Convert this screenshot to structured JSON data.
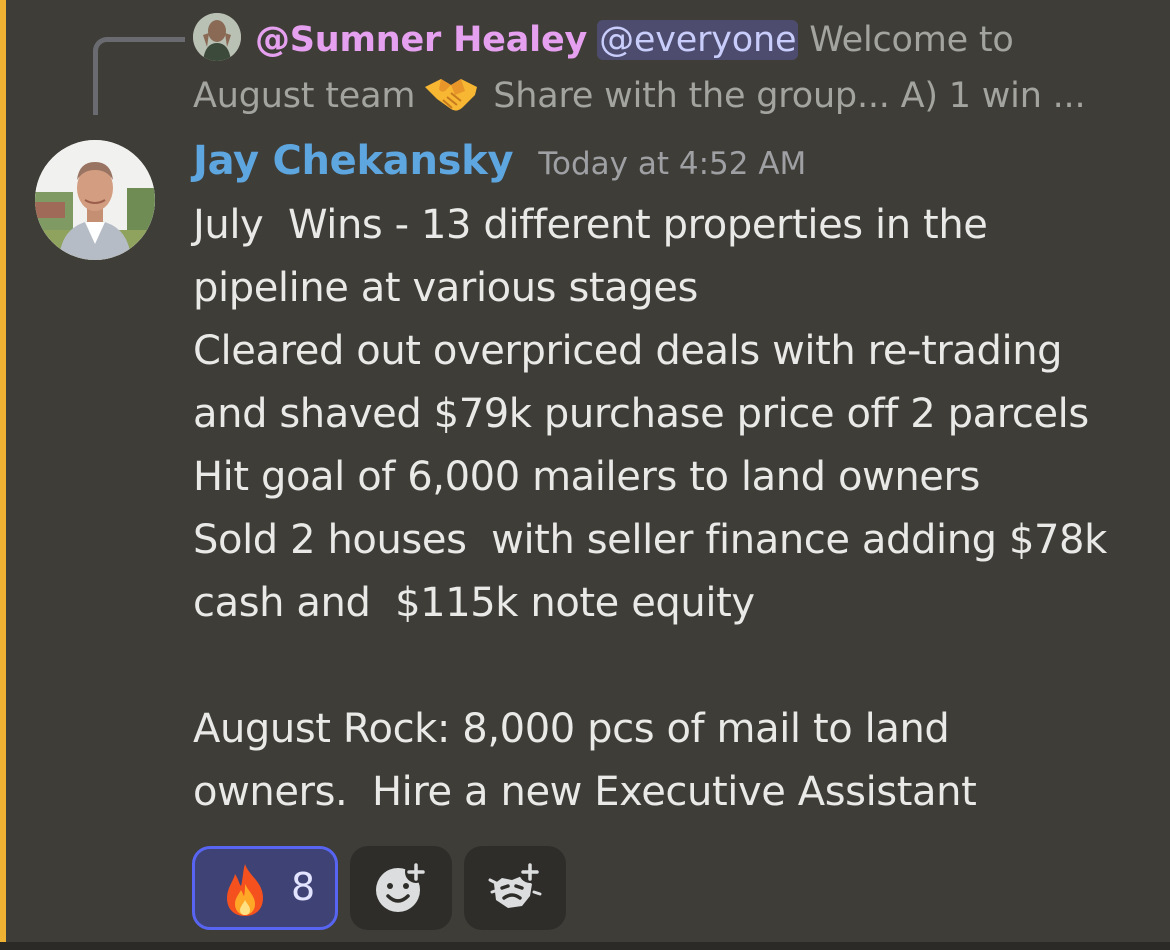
{
  "reply": {
    "author": "@Sumner Healey",
    "mention": "@everyone",
    "text_start": "Welcome to",
    "text_team": "August team",
    "text_rest": "Share with the group...  A) 1 win ..."
  },
  "message": {
    "author": "Jay Chekansky",
    "timestamp": "Today at 4:52 AM",
    "lines": [
      "July  Wins - 13 different properties in the",
      "pipeline at various stages",
      "Cleared out overpriced deals with re-trading",
      "and shaved $79k purchase price off 2 parcels",
      "Hit goal of 6,000 mailers to land owners",
      "Sold 2 houses  with seller finance adding $78k",
      "cash and  $115k note equity",
      "",
      "August Rock: 8,000 pcs of mail to land",
      "owners.  Hire a new Executive Assistant"
    ]
  },
  "reactions": [
    {
      "emoji": "fire-icon",
      "count": "8",
      "active": true
    }
  ],
  "add_reaction_buttons": [
    "add-reaction-icon",
    "add-super-reaction-icon"
  ],
  "colors": {
    "background": "#3f3d37",
    "mention_highlight_bar": "#f0b232",
    "reply_author": "#e6a0f0",
    "author": "#5ea6e0",
    "everyone_mention_bg": "#4d4c6e",
    "reaction_active_border": "#5865f2"
  }
}
